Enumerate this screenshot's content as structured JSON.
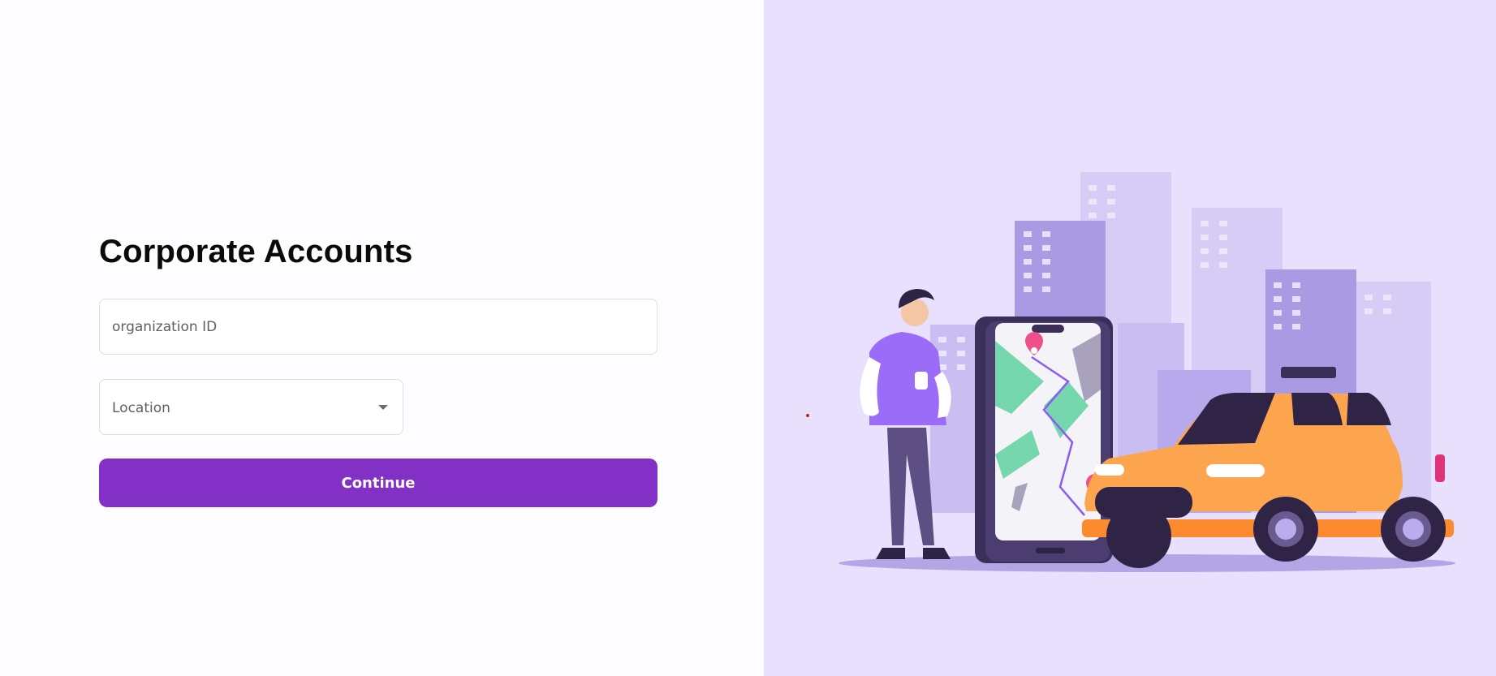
{
  "login": {
    "title": "Corporate Accounts",
    "organization_placeholder": "organization ID",
    "organization_value": "",
    "location_label": "Location",
    "continue_label": "Continue"
  },
  "colors": {
    "primary": "#8230c6",
    "panel_background": "#e8e0fc",
    "page_background": "#fdfcfe"
  },
  "illustration": {
    "subject": "person-with-phone-map-and-taxi",
    "icons": [
      "building-icon",
      "person-icon",
      "phone-map-icon",
      "location-pin-icon",
      "taxi-icon"
    ]
  }
}
